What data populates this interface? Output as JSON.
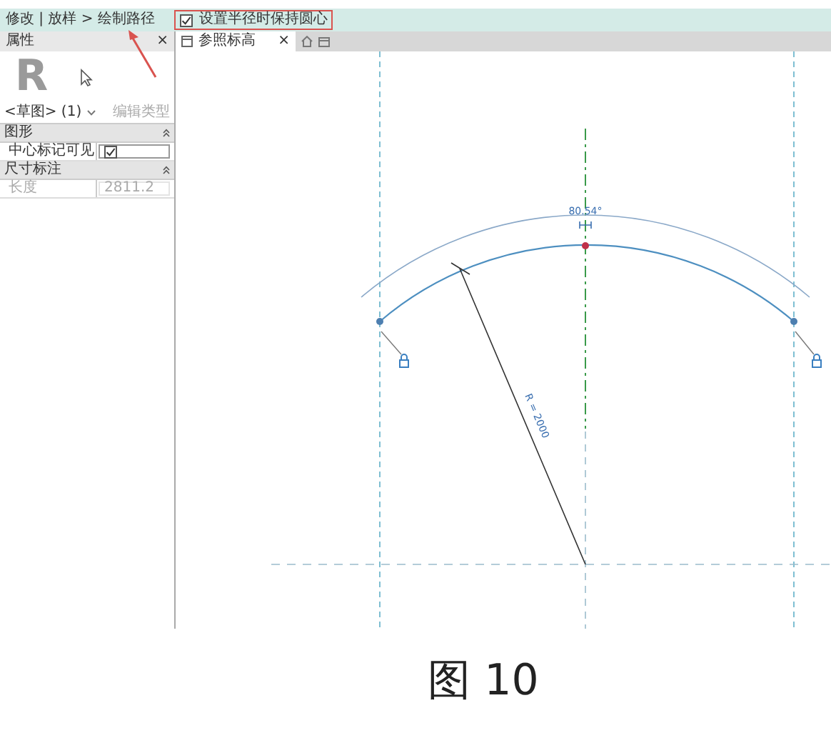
{
  "ribbon": {
    "breadcrumb": "修改 | 放样 > 绘制路径",
    "option": {
      "label": "设置半径时保持圆心",
      "checked": true
    }
  },
  "properties": {
    "title": "属性",
    "close": "×",
    "type_logo": "R",
    "type_selector": "<草图> (1)",
    "edit_type": {
      "label": "编辑类型",
      "disabled": true
    },
    "groups": [
      {
        "name": "图形",
        "rows": [
          {
            "label": "中心标记可见",
            "kind": "checkbox",
            "checked": true
          }
        ]
      },
      {
        "name": "尺寸标注",
        "rows": [
          {
            "label": "长度",
            "kind": "text",
            "value": "2811.2",
            "disabled": true
          }
        ]
      }
    ]
  },
  "view_tabs": [
    {
      "label": "参照标高",
      "close": "×",
      "selected": true
    }
  ],
  "canvas": {
    "angle": "80.54°",
    "radius": "R = 2000"
  },
  "caption": "图 10"
}
